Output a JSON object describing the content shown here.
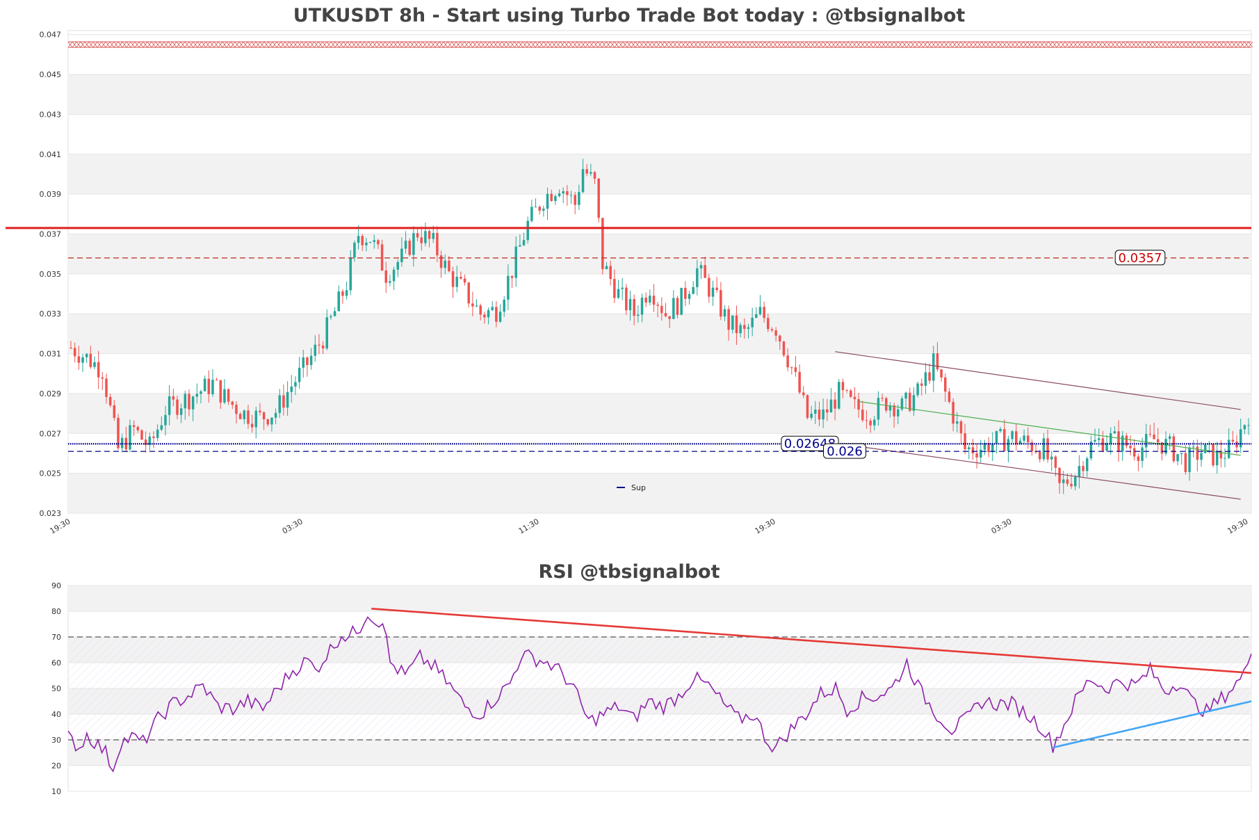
{
  "colors": {
    "up": "#26a69a",
    "down": "#ef5350",
    "resistance": "#e02020",
    "support": "#00008b",
    "rsi_line": "#8e24aa",
    "rsi_trend_down": "#e53935",
    "rsi_trend_up": "#42a5f5",
    "channel": "#8b4a62",
    "green_trend": "#4caf50"
  },
  "chart_data": [
    {
      "type": "candlestick",
      "title": "UTKUSDT 8h - Start using Turbo Trade Bot today : @tbsignalbot",
      "ylim": [
        0.023,
        0.0472
      ],
      "yticks": [
        "0.023",
        "0.025",
        "0.027",
        "0.029",
        "0.031",
        "0.033",
        "0.035",
        "0.037",
        "0.039",
        "0.041",
        "0.043",
        "0.045",
        "0.047"
      ],
      "xticks": [
        "19:30",
        "03:30",
        "11:30",
        "19:30",
        "03:30",
        "19:30"
      ],
      "grid": true,
      "legend": {
        "position": "bottom-center",
        "entries": [
          "Sup"
        ]
      },
      "price_path": [
        [
          0,
          0.0313
        ],
        [
          4,
          0.0308
        ],
        [
          8,
          0.0302
        ],
        [
          12,
          0.0262
        ],
        [
          16,
          0.0272
        ],
        [
          20,
          0.0263
        ],
        [
          24,
          0.0282
        ],
        [
          30,
          0.0288
        ],
        [
          36,
          0.0295
        ],
        [
          40,
          0.0286
        ],
        [
          44,
          0.028
        ],
        [
          48,
          0.0278
        ],
        [
          52,
          0.0281
        ],
        [
          56,
          0.0294
        ],
        [
          60,
          0.0305
        ],
        [
          64,
          0.0318
        ],
        [
          67,
          0.0331
        ],
        [
          70,
          0.0345
        ],
        [
          73,
          0.037
        ],
        [
          76,
          0.0368
        ],
        [
          78,
          0.036
        ],
        [
          80,
          0.035
        ],
        [
          84,
          0.0358
        ],
        [
          88,
          0.0371
        ],
        [
          92,
          0.0365
        ],
        [
          96,
          0.035
        ],
        [
          100,
          0.0341
        ],
        [
          104,
          0.033
        ],
        [
          108,
          0.0332
        ],
        [
          112,
          0.0352
        ],
        [
          116,
          0.0375
        ],
        [
          120,
          0.0388
        ],
        [
          124,
          0.0395
        ],
        [
          128,
          0.0385
        ],
        [
          130,
          0.0403
        ],
        [
          133,
          0.0395
        ],
        [
          135,
          0.0355
        ],
        [
          139,
          0.034
        ],
        [
          143,
          0.033
        ],
        [
          147,
          0.0344
        ],
        [
          151,
          0.033
        ],
        [
          155,
          0.0337
        ],
        [
          159,
          0.0352
        ],
        [
          163,
          0.034
        ],
        [
          167,
          0.0325
        ],
        [
          171,
          0.032
        ],
        [
          175,
          0.033
        ],
        [
          179,
          0.0323
        ],
        [
          183,
          0.0303
        ],
        [
          187,
          0.0278
        ],
        [
          191,
          0.0279
        ],
        [
          195,
          0.029
        ],
        [
          199,
          0.0283
        ],
        [
          203,
          0.028
        ],
        [
          207,
          0.0286
        ],
        [
          211,
          0.0283
        ],
        [
          215,
          0.029
        ],
        [
          219,
          0.0305
        ],
        [
          223,
          0.0285
        ],
        [
          227,
          0.0262
        ],
        [
          231,
          0.0263
        ],
        [
          235,
          0.0266
        ],
        [
          239,
          0.0268
        ],
        [
          243,
          0.0265
        ],
        [
          247,
          0.0262
        ],
        [
          251,
          0.0243
        ],
        [
          255,
          0.025
        ],
        [
          259,
          0.0264
        ],
        [
          263,
          0.0268
        ],
        [
          267,
          0.0265
        ],
        [
          271,
          0.0262
        ],
        [
          275,
          0.0267
        ],
        [
          279,
          0.0263
        ],
        [
          283,
          0.0256
        ],
        [
          287,
          0.0261
        ],
        [
          291,
          0.0258
        ],
        [
          295,
          0.0263
        ],
        [
          299,
          0.028
        ]
      ],
      "horizontal_lines": [
        {
          "value": 0.0373,
          "style": "solid",
          "color": "#e02020",
          "label": ""
        },
        {
          "value": 0.0358,
          "style": "dashed",
          "color": "#c0392b",
          "label": "0.0357"
        },
        {
          "value": 0.02648,
          "style": "dotted",
          "color": "#00008b",
          "label": "0.02648"
        },
        {
          "value": 0.0261,
          "style": "dashed",
          "color": "#00008b",
          "label": "0.026"
        },
        {
          "value": 0.0465,
          "style": "hatched",
          "color": "#d9534f",
          "label": ""
        }
      ],
      "trend_lines": [
        {
          "from": [
            194,
            0.0311
          ],
          "to": [
            297,
            0.0282
          ],
          "color": "#8b4a62"
        },
        {
          "from": [
            198,
            0.0264
          ],
          "to": [
            297,
            0.0237
          ],
          "color": "#8b4a62"
        },
        {
          "from": [
            200,
            0.0286
          ],
          "to": [
            297,
            0.0259
          ],
          "color": "#4caf50"
        }
      ]
    },
    {
      "type": "line",
      "title": "RSI @tbsignalbot",
      "ylim": [
        10,
        90
      ],
      "yticks": [
        "10",
        "20",
        "30",
        "40",
        "50",
        "60",
        "70",
        "80",
        "90"
      ],
      "bands": [
        30,
        70
      ],
      "series": [
        {
          "values_path": [
            [
              0,
              31
            ],
            [
              3,
              27
            ],
            [
              5,
              32
            ],
            [
              8,
              28
            ],
            [
              10,
              25
            ],
            [
              12,
              19
            ],
            [
              14,
              29
            ],
            [
              17,
              31
            ],
            [
              20,
              29
            ],
            [
              24,
              38
            ],
            [
              28,
              44
            ],
            [
              32,
              47
            ],
            [
              36,
              51
            ],
            [
              40,
              43
            ],
            [
              44,
              42
            ],
            [
              48,
              45
            ],
            [
              52,
              42
            ],
            [
              56,
              50
            ],
            [
              60,
              57
            ],
            [
              64,
              61
            ],
            [
              66,
              57
            ],
            [
              70,
              65
            ],
            [
              73,
              71
            ],
            [
              75,
              70
            ],
            [
              78,
              74
            ],
            [
              80,
              80
            ],
            [
              82,
              76
            ],
            [
              84,
              77
            ],
            [
              86,
              60
            ],
            [
              90,
              55
            ],
            [
              94,
              62
            ],
            [
              98,
              58
            ],
            [
              102,
              51
            ],
            [
              106,
              43
            ],
            [
              110,
              40
            ],
            [
              114,
              46
            ],
            [
              118,
              52
            ],
            [
              121,
              63
            ],
            [
              124,
              62
            ],
            [
              128,
              60
            ],
            [
              132,
              56
            ],
            [
              135,
              50
            ],
            [
              139,
              37
            ],
            [
              143,
              40
            ],
            [
              147,
              43
            ],
            [
              151,
              38
            ],
            [
              155,
              45
            ],
            [
              159,
              43
            ],
            [
              163,
              47
            ],
            [
              167,
              54
            ],
            [
              171,
              51
            ],
            [
              175,
              44
            ],
            [
              179,
              38
            ],
            [
              183,
              40
            ],
            [
              187,
              29
            ],
            [
              189,
              27
            ],
            [
              193,
              34
            ],
            [
              197,
              40
            ],
            [
              201,
              48
            ],
            [
              205,
              50
            ],
            [
              208,
              42
            ],
            [
              212,
              46
            ],
            [
              216,
              47
            ],
            [
              220,
              50
            ],
            [
              224,
              60
            ],
            [
              228,
              48
            ],
            [
              232,
              40
            ],
            [
              236,
              34
            ],
            [
              240,
              38
            ],
            [
              244,
              45
            ],
            [
              248,
              44
            ],
            [
              252,
              44
            ],
            [
              256,
              40
            ],
            [
              260,
              35
            ],
            [
              263,
              28
            ],
            [
              265,
              33
            ],
            [
              269,
              45
            ],
            [
              273,
              54
            ],
            [
              277,
              50
            ],
            [
              281,
              53
            ],
            [
              285,
              51
            ],
            [
              289,
              57
            ],
            [
              293,
              49
            ],
            [
              297,
              53
            ],
            [
              300,
              45
            ],
            [
              304,
              41
            ],
            [
              308,
              46
            ],
            [
              312,
              52
            ],
            [
              314,
              55
            ],
            [
              316,
              66
            ]
          ]
        }
      ],
      "trend_lines": [
        {
          "from": [
            81,
            81
          ],
          "to": [
            316,
            56
          ],
          "color": "#e53935"
        },
        {
          "from": [
            263,
            27
          ],
          "to": [
            316,
            45
          ],
          "color": "#42a5f5"
        }
      ]
    }
  ]
}
